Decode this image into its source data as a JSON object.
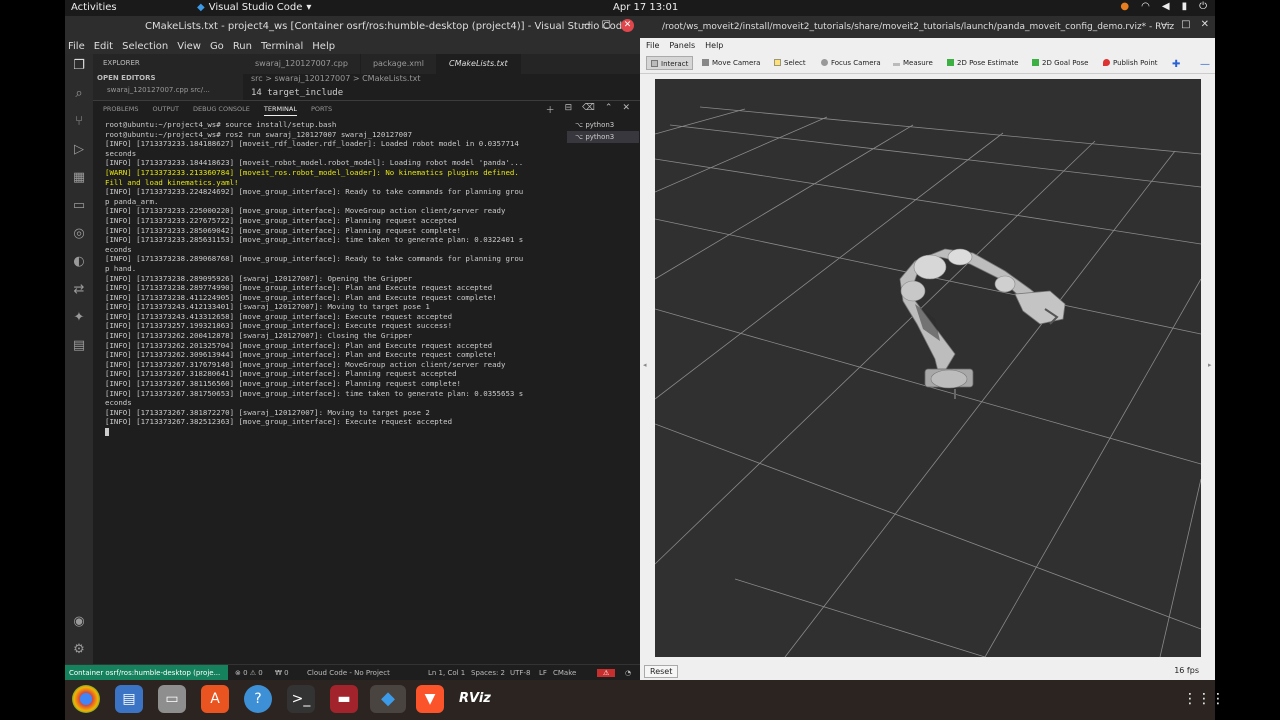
{
  "topbar": {
    "activities": "Activities",
    "app": "Visual Studio Code",
    "clock": "Apr 17  13:01"
  },
  "vscode": {
    "title": "CMakeLists.txt - project4_ws [Container osrf/ros:humble-desktop (project4)] - Visual Studio Code",
    "menu": [
      "File",
      "Edit",
      "Selection",
      "View",
      "Go",
      "Run",
      "Terminal",
      "Help"
    ],
    "sidebar": {
      "explorer": "EXPLORER",
      "open_editors": "OPEN EDITORS",
      "open_file": "swaraj_120127007.cpp src/..."
    },
    "tabs": [
      "swaraj_120127007.cpp",
      "package.xml",
      "CMakeLists.txt"
    ],
    "breadcrumb": "src > swaraj_120127007 > CMakeLists.txt",
    "code_line": "14    target_include",
    "panel_tabs": [
      "PROBLEMS",
      "OUTPUT",
      "DEBUG CONSOLE",
      "TERMINAL",
      "PORTS"
    ],
    "terminals": [
      "python3",
      "python3"
    ],
    "terminal_lines": [
      {
        "text": "root@ubuntu:~/project4_ws# source install/setup.bash",
        "warn": false
      },
      {
        "text": "root@ubuntu:~/project4_ws# ros2 run swaraj_120127007 swaraj_120127007",
        "warn": false
      },
      {
        "text": "[INFO] [1713373233.184188627] [moveit_rdf_loader.rdf_loader]: Loaded robot model in 0.0357714",
        "warn": false
      },
      {
        "text": "seconds",
        "warn": false
      },
      {
        "text": "[INFO] [1713373233.184418623] [moveit_robot_model.robot_model]: Loading robot model 'panda'...",
        "warn": false
      },
      {
        "text": "[WARN] [1713373233.213360784] [moveit_ros.robot_model_loader]: No kinematics plugins defined.",
        "warn": true
      },
      {
        "text": "Fill and load kinematics.yaml!",
        "warn": true
      },
      {
        "text": "[INFO] [1713373233.224824692] [move_group_interface]: Ready to take commands for planning grou",
        "warn": false
      },
      {
        "text": "p panda_arm.",
        "warn": false
      },
      {
        "text": "[INFO] [1713373233.225000220] [move_group_interface]: MoveGroup action client/server ready",
        "warn": false
      },
      {
        "text": "[INFO] [1713373233.227675722] [move_group_interface]: Planning request accepted",
        "warn": false
      },
      {
        "text": "[INFO] [1713373233.285069042] [move_group_interface]: Planning request complete!",
        "warn": false
      },
      {
        "text": "[INFO] [1713373233.285631153] [move_group_interface]: time taken to generate plan: 0.0322401 s",
        "warn": false
      },
      {
        "text": "econds",
        "warn": false
      },
      {
        "text": "[INFO] [1713373238.289068768] [move_group_interface]: Ready to take commands for planning grou",
        "warn": false
      },
      {
        "text": "p hand.",
        "warn": false
      },
      {
        "text": "[INFO] [1713373238.289095926] [swaraj_120127007]: Opening the Gripper",
        "warn": false
      },
      {
        "text": "[INFO] [1713373238.289774990] [move_group_interface]: Plan and Execute request accepted",
        "warn": false
      },
      {
        "text": "[INFO] [1713373238.411224905] [move_group_interface]: Plan and Execute request complete!",
        "warn": false
      },
      {
        "text": "[INFO] [1713373243.412133401] [swaraj_120127007]: Moving to target pose 1",
        "warn": false
      },
      {
        "text": "[INFO] [1713373243.413312658] [move_group_interface]: Execute request accepted",
        "warn": false
      },
      {
        "text": "[INFO] [1713373257.199321863] [move_group_interface]: Execute request success!",
        "warn": false
      },
      {
        "text": "[INFO] [1713373262.200412878] [swaraj_120127007]: Closing the Gripper",
        "warn": false
      },
      {
        "text": "[INFO] [1713373262.201325704] [move_group_interface]: Plan and Execute request accepted",
        "warn": false
      },
      {
        "text": "[INFO] [1713373262.309613944] [move_group_interface]: Plan and Execute request complete!",
        "warn": false
      },
      {
        "text": "[INFO] [1713373267.317679140] [move_group_interface]: MoveGroup action client/server ready",
        "warn": false
      },
      {
        "text": "[INFO] [1713373267.318280641] [move_group_interface]: Planning request accepted",
        "warn": false
      },
      {
        "text": "[INFO] [1713373267.381156560] [move_group_interface]: Planning request complete!",
        "warn": false
      },
      {
        "text": "[INFO] [1713373267.381750653] [move_group_interface]: time taken to generate plan: 0.0355653 s",
        "warn": false
      },
      {
        "text": "econds",
        "warn": false
      },
      {
        "text": "[INFO] [1713373267.381872270] [swaraj_120127007]: Moving to target pose 2",
        "warn": false
      },
      {
        "text": "[INFO] [1713373267.382512363] [move_group_interface]: Execute request accepted",
        "warn": false
      }
    ],
    "status": {
      "remote": "Container osrf/ros:humble-desktop (proje...",
      "problems": "⊗ 0 ⚠ 0",
      "ports": "₩ 0",
      "cloud": "Cloud Code - No Project",
      "position": "Ln 1, Col 1",
      "spaces": "Spaces: 2",
      "encoding": "UTF-8",
      "eol": "LF",
      "language": "CMake"
    }
  },
  "rviz": {
    "title": "/root/ws_moveit2/install/moveit2_tutorials/share/moveit2_tutorials/launch/panda_moveit_config_demo.rviz* - RViz",
    "menu": [
      "File",
      "Panels",
      "Help"
    ],
    "tools": [
      "Interact",
      "Move Camera",
      "Select",
      "Focus Camera",
      "Measure",
      "2D Pose Estimate",
      "2D Goal Pose",
      "Publish Point"
    ],
    "reset": "Reset",
    "fps": "16 fps",
    "colors": {
      "grid": "#8a8a8a",
      "background": "#303030"
    }
  },
  "dock": {
    "apps": [
      "chrome-icon",
      "text-editor-icon",
      "files-icon",
      "software-center-icon",
      "help-icon",
      "terminal-icon",
      "gitkraken-icon",
      "vscode-icon",
      "brave-icon",
      "rviz-icon"
    ],
    "rviz_label": "RViz"
  }
}
